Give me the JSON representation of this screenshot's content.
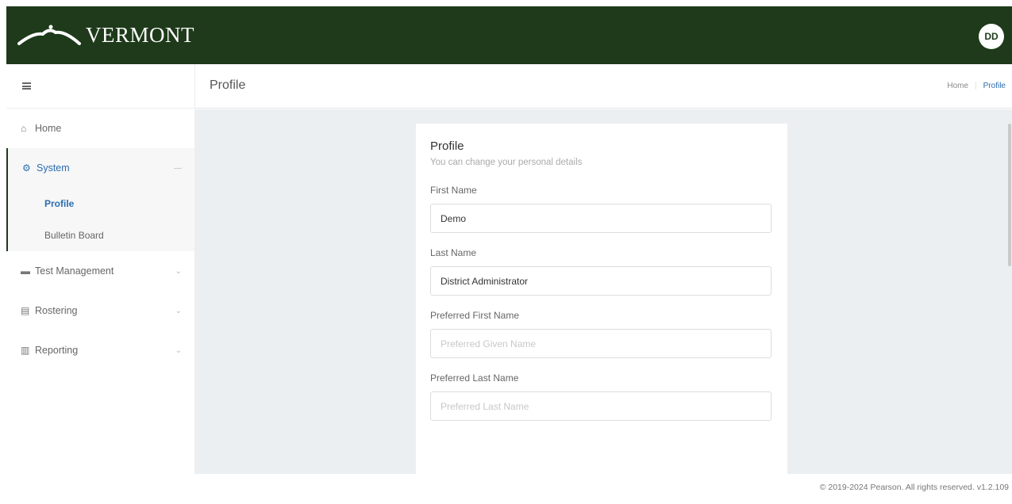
{
  "brand": {
    "name": "VERMONT",
    "primary": "#1e3a1a",
    "link": "#2b6cb0"
  },
  "user": {
    "initials": "DD"
  },
  "sidebar": {
    "items": [
      {
        "label": "Home",
        "icon": "home-icon"
      },
      {
        "label": "System",
        "icon": "gear-icon",
        "expanded": true,
        "children": [
          {
            "label": "Profile",
            "active": true
          },
          {
            "label": "Bulletin Board"
          }
        ]
      },
      {
        "label": "Test Management",
        "icon": "folder-icon"
      },
      {
        "label": "Rostering",
        "icon": "clipboard-icon"
      },
      {
        "label": "Reporting",
        "icon": "chart-icon"
      }
    ]
  },
  "header": {
    "title": "Profile",
    "breadcrumb": [
      "Home",
      "Profile"
    ]
  },
  "profile": {
    "title": "Profile",
    "subtitle": "You can change your personal details",
    "first_name": {
      "label": "First Name",
      "value": "Demo"
    },
    "last_name": {
      "label": "Last Name",
      "value": "District Administrator"
    },
    "preferred_first": {
      "label": "Preferred First Name",
      "value": "",
      "placeholder": "Preferred Given Name"
    },
    "preferred_last": {
      "label": "Preferred Last Name",
      "value": "",
      "placeholder": "Preferred Last Name"
    }
  },
  "footer": {
    "text": "© 2019-2024 Pearson. All rights reserved. v1.2.109"
  }
}
